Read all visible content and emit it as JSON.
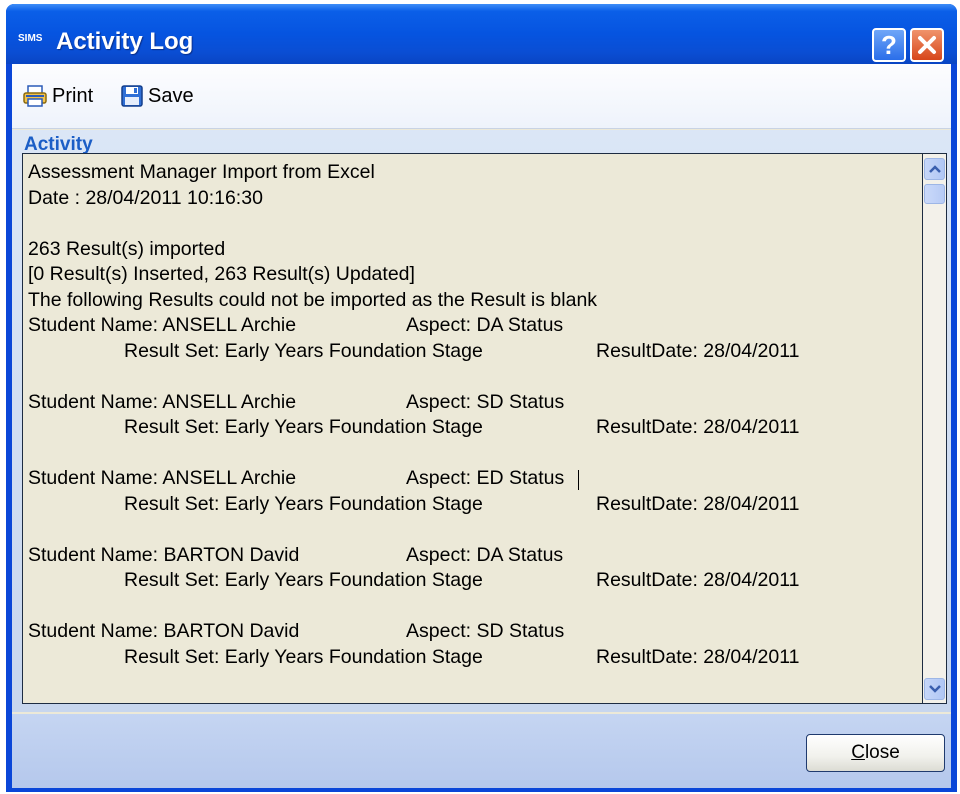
{
  "window": {
    "app_logo": "SIMS",
    "title": "Activity Log",
    "help_label": "?"
  },
  "toolbar": {
    "print_label": "Print",
    "save_label": "Save"
  },
  "activity": {
    "group_title": "Activity",
    "header_lines": [
      "Assessment Manager Import from Excel",
      "Date : 28/04/2011 10:16:30"
    ],
    "summary_lines": [
      "263 Result(s) imported",
      "[0 Result(s) Inserted, 263 Result(s) Updated]",
      "The following Results could not be imported as the Result is blank"
    ],
    "records": [
      {
        "student": "Student Name: ANSELL Archie",
        "aspect": "Aspect: DA Status",
        "result_set": "Result Set: Early Years Foundation Stage",
        "result_date": "ResultDate: 28/04/2011"
      },
      {
        "student": "Student Name: ANSELL Archie",
        "aspect": "Aspect: SD Status",
        "result_set": "Result Set: Early Years Foundation Stage",
        "result_date": "ResultDate: 28/04/2011"
      },
      {
        "student": "Student Name: ANSELL Archie",
        "aspect": "Aspect: ED Status",
        "result_set": "Result Set: Early Years Foundation Stage",
        "result_date": "ResultDate: 28/04/2011"
      },
      {
        "student": "Student Name: BARTON David",
        "aspect": "Aspect: DA Status",
        "result_set": "Result Set: Early Years Foundation Stage",
        "result_date": "ResultDate: 28/04/2011"
      },
      {
        "student": "Student Name: BARTON David",
        "aspect": "Aspect: SD Status",
        "result_set": "Result Set: Early Years Foundation Stage",
        "result_date": "ResultDate: 28/04/2011"
      }
    ]
  },
  "footer": {
    "close_label_mnemonic": "C",
    "close_label_rest": "lose"
  },
  "colors": {
    "title_bar": "#0654e0",
    "group_title": "#1b5ec6",
    "log_background": "#ece9d8"
  }
}
